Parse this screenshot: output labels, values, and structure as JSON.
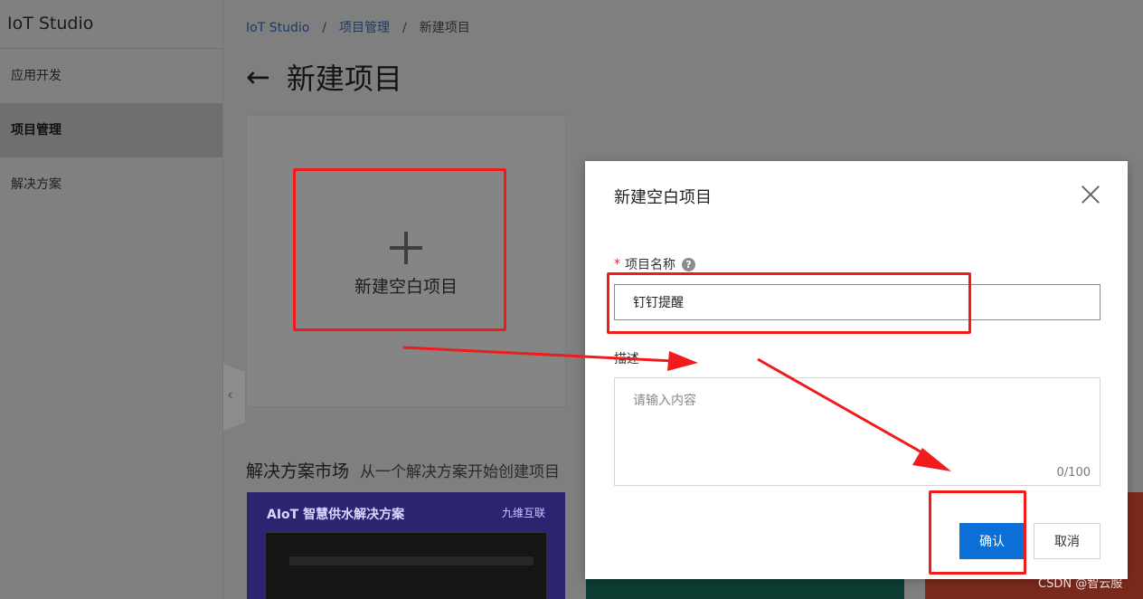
{
  "sidebar": {
    "brand": "IoT Studio",
    "items": [
      {
        "label": "应用开发"
      },
      {
        "label": "项目管理"
      },
      {
        "label": "解决方案"
      }
    ]
  },
  "breadcrumb": {
    "items": [
      "IoT Studio",
      "项目管理",
      "新建项目"
    ],
    "separator": "/"
  },
  "page": {
    "title": "新建项目"
  },
  "blank_card": {
    "label": "新建空白项目"
  },
  "market": {
    "title": "解决方案市场",
    "subtitle": "从一个解决方案开始创建项目",
    "cards": [
      {
        "title": "AIoT 智慧供水解决方案",
        "logo": "九维互联"
      }
    ]
  },
  "dialog": {
    "title": "新建空白项目",
    "name_label": "项目名称",
    "name_value": "钉钉提醒",
    "desc_label": "描述",
    "desc_placeholder": "请输入内容",
    "desc_counter": "0/100",
    "confirm_label": "确认",
    "cancel_label": "取消"
  },
  "watermark": "CSDN @智云服",
  "colors": {
    "annotation_red": "#f21b1b",
    "primary_blue": "#0a6fd6",
    "required_red": "#f5222d"
  }
}
